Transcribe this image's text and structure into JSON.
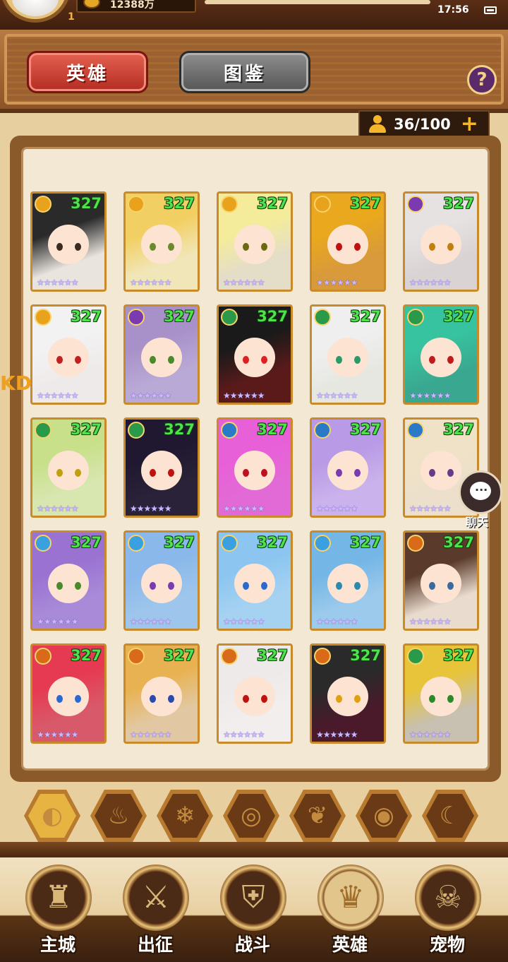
{
  "status": {
    "time": "17:56",
    "gold": "12388万",
    "level": "1"
  },
  "tabs": {
    "hero": "英雄",
    "book": "图鉴",
    "help": "?"
  },
  "hero_count": {
    "text": "36/100",
    "plus": "+"
  },
  "side_text": "KD",
  "chat": {
    "label": "聊天",
    "dots": "···"
  },
  "heroes": [
    {
      "level": "327",
      "element": "light",
      "el_color": "#e8a21c",
      "stars": "★★★★★★",
      "bg": "#e9e4de",
      "hair": "#2a2a2a",
      "eye": "#3a2a20"
    },
    {
      "level": "327",
      "element": "light",
      "el_color": "#e8a21c",
      "stars": "★★★★★★",
      "bg": "#f1e6b8",
      "hair": "#f2cf62",
      "eye": "#6b8a2a"
    },
    {
      "level": "327",
      "element": "light",
      "el_color": "#e8a21c",
      "stars": "★★★★★★",
      "bg": "#e4ddc8",
      "hair": "#f4ec9a",
      "eye": "#6b6a10"
    },
    {
      "level": "327",
      "element": "light",
      "el_color": "#e8a21c",
      "stars": "★★★★★★",
      "bg": "#d89a3a",
      "hair": "#e9a81e",
      "eye": "#c01010"
    },
    {
      "level": "327",
      "element": "dark",
      "el_color": "#7a3ab0",
      "stars": "★★★★★★",
      "bg": "#d9d3d3",
      "hair": "#e7e2e2",
      "eye": "#c08010"
    },
    {
      "level": "327",
      "element": "light",
      "el_color": "#e8a21c",
      "stars": "★★★★★★",
      "bg": "#efeaea",
      "hair": "#f2f2f2",
      "eye": "#c02020"
    },
    {
      "level": "327",
      "element": "dark",
      "el_color": "#7a3ab0",
      "stars": "★★★★★★",
      "bg": "#b9a9d6",
      "hair": "#a891c9",
      "eye": "#4a8a2a"
    },
    {
      "level": "327",
      "element": "nature",
      "el_color": "#2a9a4a",
      "stars": "★★★★★★",
      "bg": "#5a1a1a",
      "hair": "#1a1a1a",
      "eye": "#e02020"
    },
    {
      "level": "327",
      "element": "nature",
      "el_color": "#2a9a4a",
      "stars": "★★★★★★",
      "bg": "#e7e7e2",
      "hair": "#efefef",
      "eye": "#2a9a6a"
    },
    {
      "level": "327",
      "element": "nature",
      "el_color": "#2a9a4a",
      "stars": "★★★★★★",
      "bg": "#3aa890",
      "hair": "#38c3a0",
      "eye": "#c01a1a"
    },
    {
      "level": "327",
      "element": "nature",
      "el_color": "#2a9a4a",
      "stars": "★★★★★★",
      "bg": "#d8e6b0",
      "hair": "#c8e08a",
      "eye": "#c0a010"
    },
    {
      "level": "327",
      "element": "nature",
      "el_color": "#2a9a4a",
      "stars": "★★★★★★",
      "bg": "#2a2238",
      "hair": "#201830",
      "eye": "#c01010"
    },
    {
      "level": "327",
      "element": "water",
      "el_color": "#2a7ac8",
      "stars": "★★★★★★",
      "bg": "#e26ad6",
      "hair": "#e860d8",
      "eye": "#c01020"
    },
    {
      "level": "327",
      "element": "water",
      "el_color": "#2a7ac8",
      "stars": "★★★★★★",
      "bg": "#cab2ec",
      "hair": "#b99ae6",
      "eye": "#7a3ab0"
    },
    {
      "level": "327",
      "element": "water",
      "el_color": "#2a7ac8",
      "stars": "★★★★★★",
      "bg": "#ece0cc",
      "hair": "#f0e2c6",
      "eye": "#6a3a8a"
    },
    {
      "level": "327",
      "element": "ice",
      "el_color": "#3aa0e0",
      "stars": "★★★★★★",
      "bg": "#a88ad8",
      "hair": "#9a72d2",
      "eye": "#4a8a2a"
    },
    {
      "level": "327",
      "element": "ice",
      "el_color": "#3aa0e0",
      "stars": "★★★★★★",
      "bg": "#9ec6ec",
      "hair": "#8ab8ea",
      "eye": "#7a3ab0"
    },
    {
      "level": "327",
      "element": "ice",
      "el_color": "#3aa0e0",
      "stars": "★★★★★★",
      "bg": "#a6d2f2",
      "hair": "#8cc6f0",
      "eye": "#2a6ad0"
    },
    {
      "level": "327",
      "element": "ice",
      "el_color": "#3aa0e0",
      "stars": "★★★★★★",
      "bg": "#9ccaec",
      "hair": "#74b6e6",
      "eye": "#2a8ab0"
    },
    {
      "level": "327",
      "element": "fire",
      "el_color": "#d86a1a",
      "stars": "★★★★★★",
      "bg": "#e9dccf",
      "hair": "#5a3a2a",
      "eye": "#3a6aa0"
    },
    {
      "level": "327",
      "element": "fire",
      "el_color": "#d86a1a",
      "stars": "★★★★★★",
      "bg": "#d85a6a",
      "hair": "#e63a52",
      "eye": "#2a6ad0"
    },
    {
      "level": "327",
      "element": "fire",
      "el_color": "#d86a1a",
      "stars": "★★★★★★",
      "bg": "#e2c8a2",
      "hair": "#e8b252",
      "eye": "#2a4ab0"
    },
    {
      "level": "327",
      "element": "fire",
      "el_color": "#d86a1a",
      "stars": "★★★★★★",
      "bg": "#f2eeee",
      "hair": "#eeeaea",
      "eye": "#c01010"
    },
    {
      "level": "327",
      "element": "fire",
      "el_color": "#d86a1a",
      "stars": "★★★★★★",
      "bg": "#4a1a2a",
      "hair": "#2a2a2a",
      "eye": "#e0a010"
    },
    {
      "level": "327",
      "element": "nature",
      "el_color": "#2a9a4a",
      "stars": "★★★★★★",
      "bg": "#c8c0b0",
      "hair": "#e8c43a",
      "eye": "#2a8a2a"
    }
  ],
  "filters": [
    {
      "name": "all",
      "symbol": "◐"
    },
    {
      "name": "fire",
      "symbol": "♨"
    },
    {
      "name": "ice",
      "symbol": "❄"
    },
    {
      "name": "water",
      "symbol": "◎"
    },
    {
      "name": "nature",
      "symbol": "❦"
    },
    {
      "name": "dark",
      "symbol": "◉"
    },
    {
      "name": "light",
      "symbol": "☾"
    }
  ],
  "nav": [
    {
      "label": "主城",
      "icon": "castle-icon",
      "glyph": "♜"
    },
    {
      "label": "出征",
      "icon": "crossed-swords-icon",
      "glyph": "⚔"
    },
    {
      "label": "战斗",
      "icon": "shield-icon",
      "glyph": "⛨"
    },
    {
      "label": "英雄",
      "icon": "hooded-hero-icon",
      "glyph": "♛"
    },
    {
      "label": "宠物",
      "icon": "dragon-icon",
      "glyph": "☠"
    }
  ]
}
